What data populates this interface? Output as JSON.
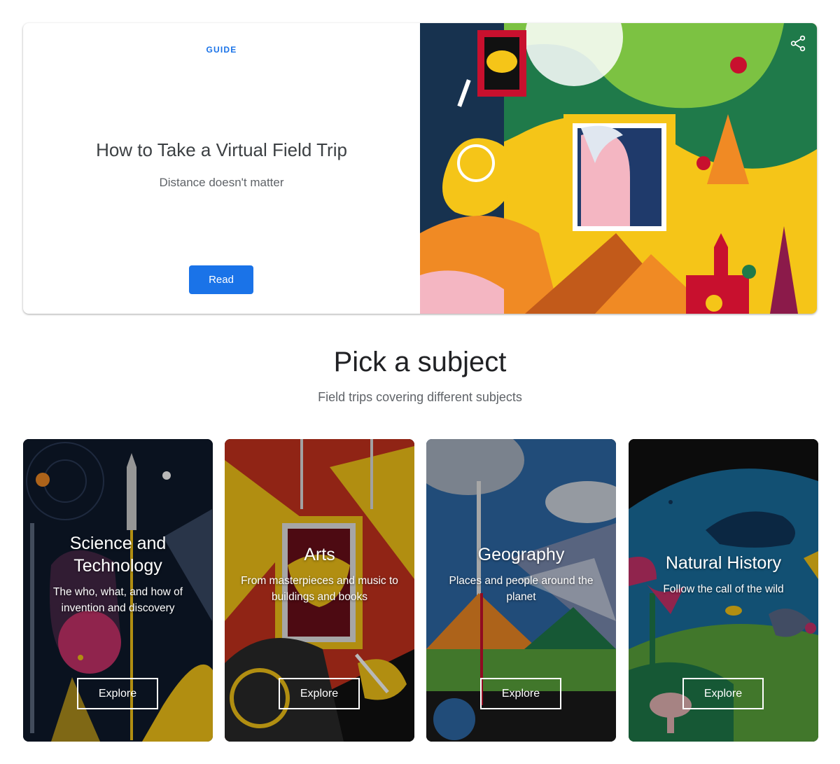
{
  "hero": {
    "kicker": "GUIDE",
    "title": "How to Take a Virtual Field Trip",
    "subtitle": "Distance doesn't matter",
    "button_label": "Read",
    "share_icon": "share-icon"
  },
  "section": {
    "title": "Pick a subject",
    "subtitle": "Field trips covering different subjects"
  },
  "cards": [
    {
      "title_line1": "Science and",
      "title_line2": "Technology",
      "desc_line1": "The who, what, and how of",
      "desc_line2": "invention and discovery",
      "button_label": "Explore"
    },
    {
      "title_line1": "Arts",
      "desc_line1": "From masterpieces and music to",
      "desc_line2": "buildings and books",
      "button_label": "Explore"
    },
    {
      "title_line1": "Geography",
      "desc_line1": "Places and people around the",
      "desc_line2": "planet",
      "button_label": "Explore"
    },
    {
      "title_line1": "Natural History",
      "desc_line1": "Follow the call of the wild",
      "button_label": "Explore"
    }
  ],
  "colors": {
    "accent": "#1a73e8",
    "text_primary": "#202124",
    "text_secondary": "#5f6368"
  }
}
